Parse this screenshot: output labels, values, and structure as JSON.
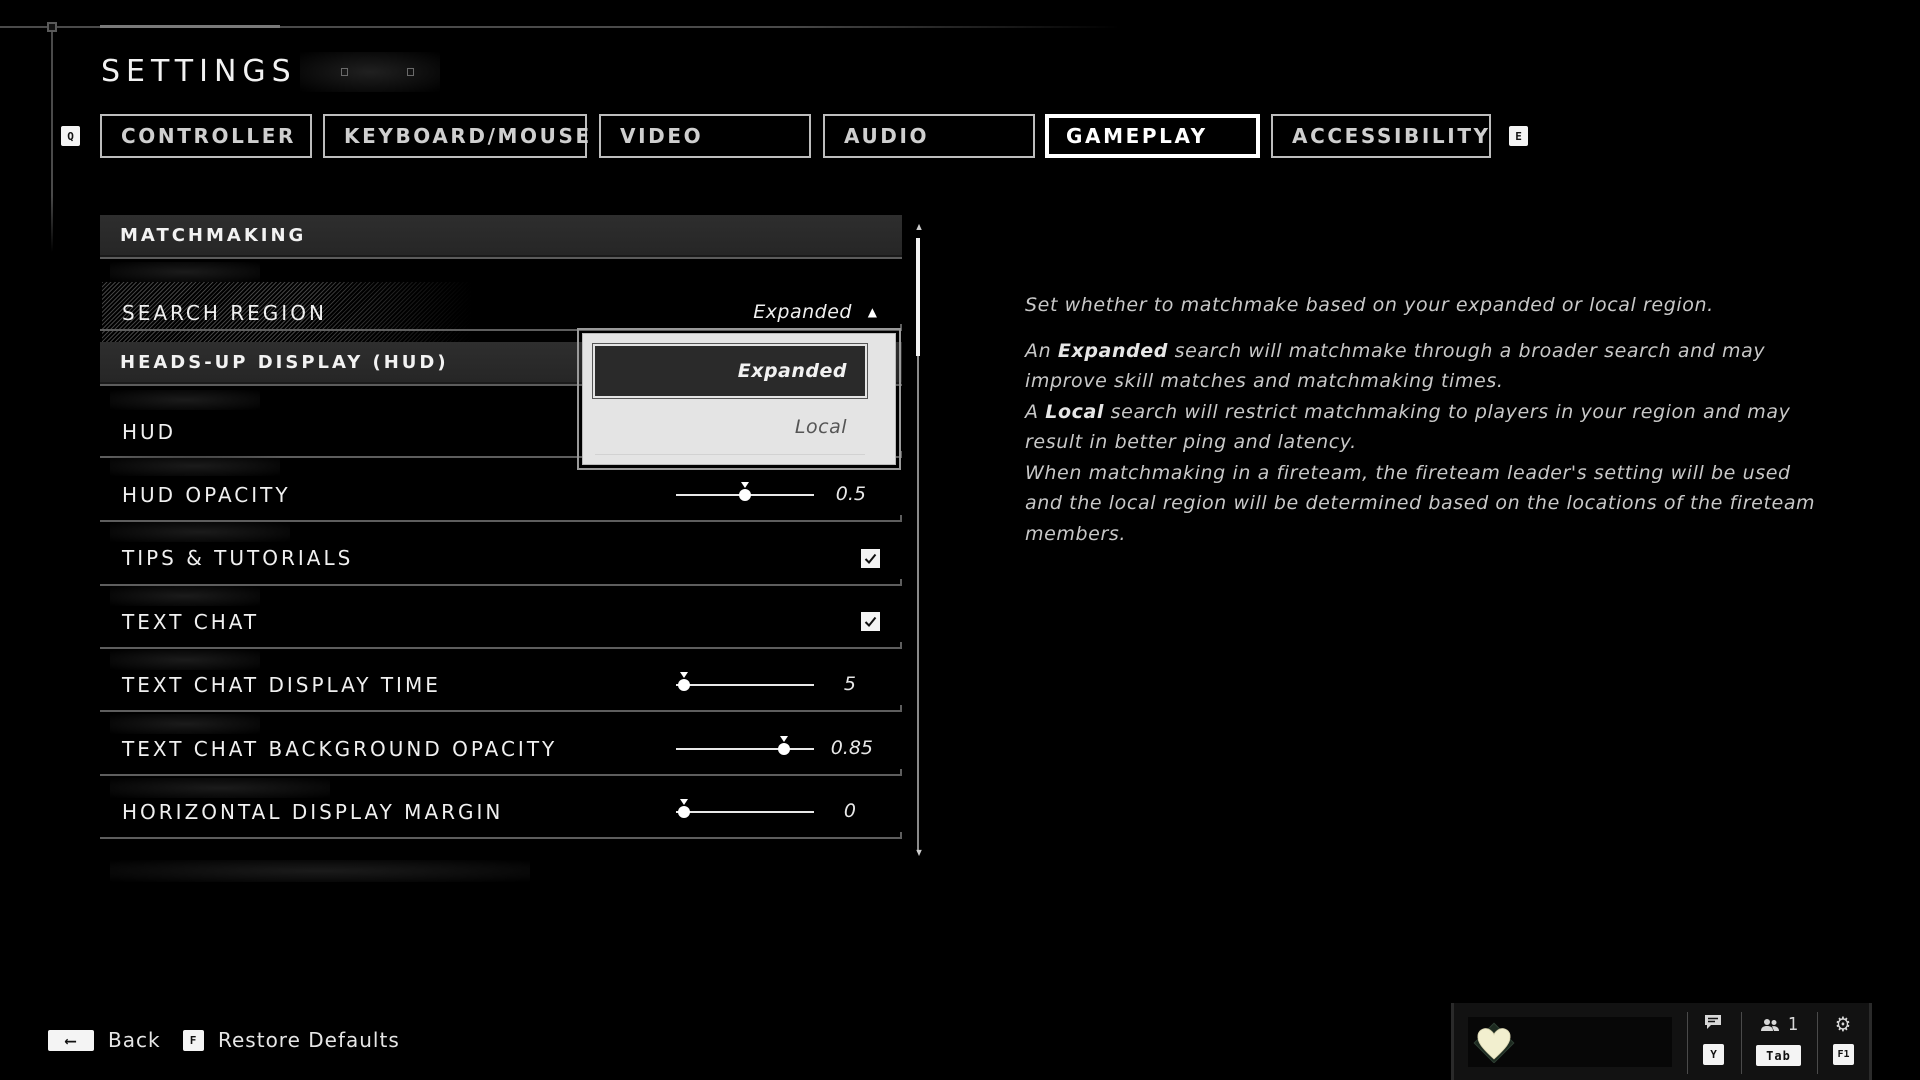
{
  "header": {
    "title": "SETTINGS",
    "prev_tab_key": "Q",
    "next_tab_key": "E"
  },
  "tabs": [
    {
      "label": "CONTROLLER",
      "active": false
    },
    {
      "label": "KEYBOARD/MOUSE",
      "active": false
    },
    {
      "label": "VIDEO",
      "active": false
    },
    {
      "label": "AUDIO",
      "active": false
    },
    {
      "label": "GAMEPLAY",
      "active": true
    },
    {
      "label": "ACCESSIBILITY",
      "active": false
    }
  ],
  "sections": {
    "matchmaking": {
      "title": "MATCHMAKING",
      "search_region": {
        "label": "SEARCH REGION",
        "value": "Expanded",
        "open": true,
        "options": [
          "Expanded",
          "Local"
        ],
        "selected": "Expanded"
      }
    },
    "hud": {
      "title": "HEADS-UP DISPLAY (HUD)",
      "hud": {
        "label": "HUD"
      },
      "hud_opacity": {
        "label": "HUD OPACITY",
        "value": "0.5",
        "fraction": 0.5
      },
      "tips": {
        "label": "TIPS & TUTORIALS",
        "checked": true
      },
      "text_chat": {
        "label": "TEXT CHAT",
        "checked": true
      },
      "chat_display_time": {
        "label": "TEXT CHAT DISPLAY TIME",
        "value": "5",
        "fraction": 0.0
      },
      "chat_bg_opacity": {
        "label": "TEXT CHAT BACKGROUND OPACITY",
        "value": "0.85",
        "fraction": 0.82
      },
      "horizontal_margin": {
        "label": "HORIZONTAL DISPLAY MARGIN",
        "value": "0",
        "fraction": 0.0
      }
    }
  },
  "description": {
    "line1": "Set whether to matchmake based on your expanded or local region.",
    "p2_prefix": "An ",
    "p2_bold": "Expanded",
    "p2_rest": " search will matchmake through a broader search and may improve skill matches and matchmaking times.",
    "p3_prefix": "A ",
    "p3_bold": "Local",
    "p3_rest": " search will restrict matchmaking to players in your region and may result in better ping and latency.",
    "p4": "When matchmaking in a fireteam, the fireteam leader's setting will be used and the local region will be determined based on the locations of the fireteam members."
  },
  "footer": {
    "back_label": "Back",
    "back_key": "⟵",
    "restore_label": "Restore Defaults",
    "restore_key": "F"
  },
  "social": {
    "chat_key": "Y",
    "fireteam_count": "1",
    "fireteam_key": "Tab",
    "settings_key": "F1",
    "emblem_color": "#f2efcf"
  }
}
